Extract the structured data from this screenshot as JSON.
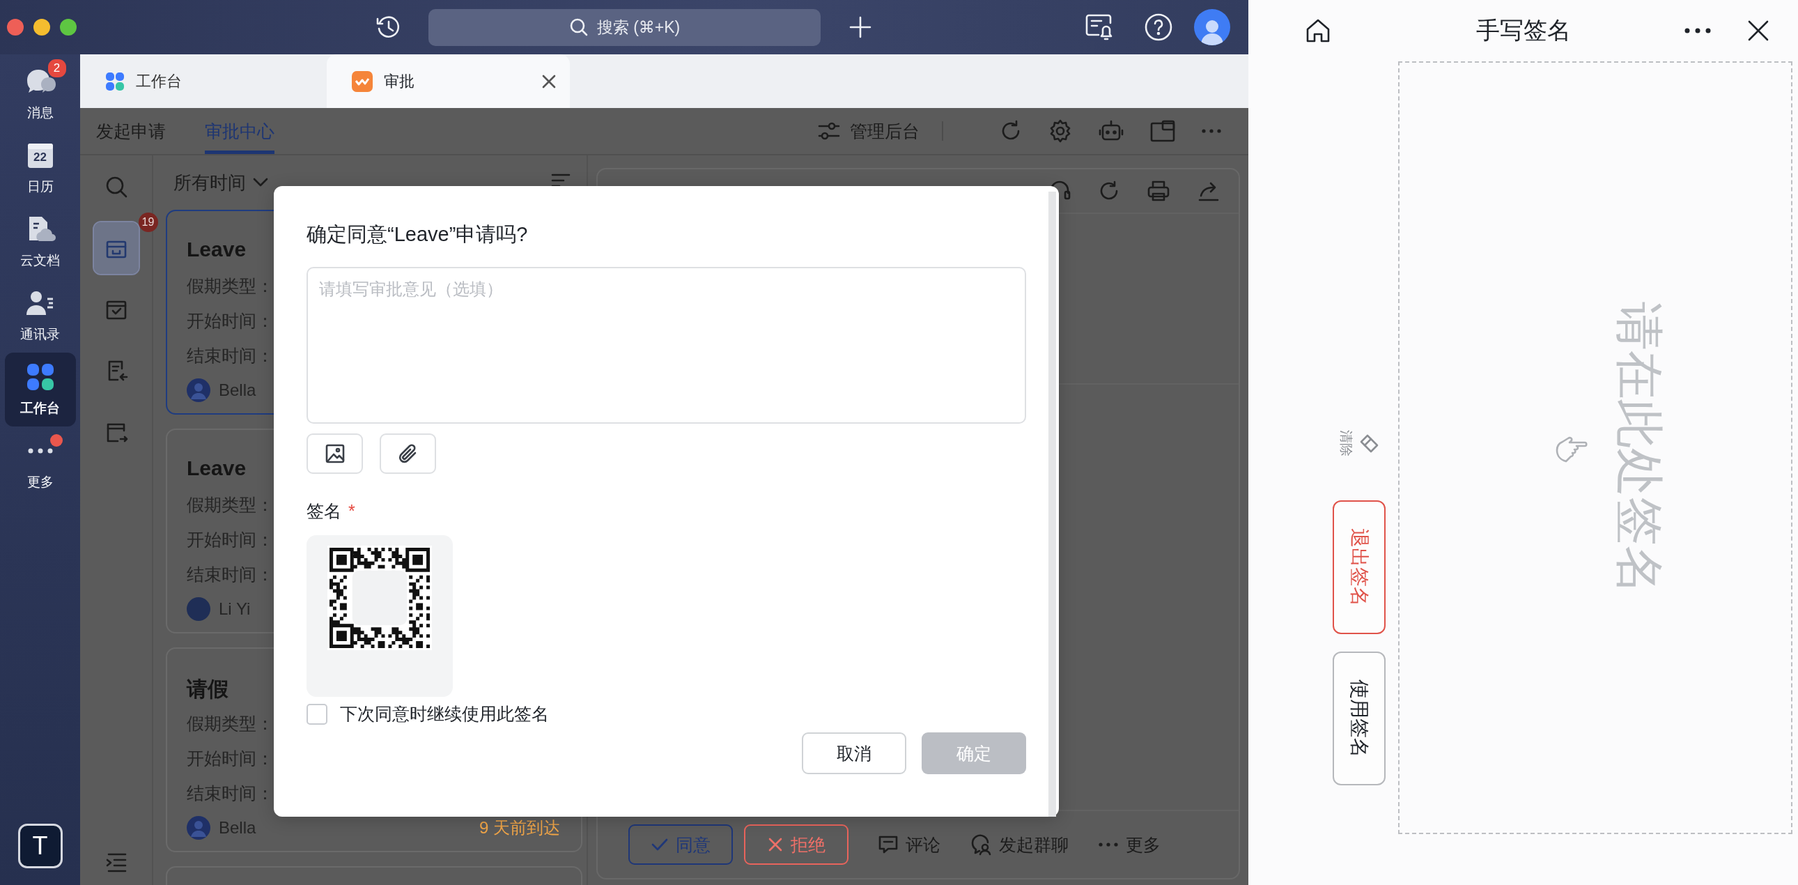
{
  "title_bar": {
    "search": {
      "placeholder": "搜索 (⌘+K)"
    }
  },
  "rail": {
    "items": [
      {
        "kind": "message",
        "label": "消息",
        "badge": "2",
        "selected": false,
        "dot": false
      },
      {
        "kind": "calendar",
        "label": "日历",
        "icon_text": "22",
        "selected": false,
        "dot": false
      },
      {
        "kind": "docs",
        "label": "云文档",
        "selected": false,
        "dot": false
      },
      {
        "kind": "contacts",
        "label": "通讯录",
        "selected": false,
        "dot": false
      },
      {
        "kind": "workspace",
        "label": "工作台",
        "selected": true,
        "dot": false
      },
      {
        "kind": "more",
        "label": "更多",
        "selected": false,
        "dot": true
      }
    ],
    "avatar_letter": "T"
  },
  "tabs": [
    {
      "kind": "workspace",
      "label": "工作台",
      "selected": false
    },
    {
      "kind": "approval",
      "label": "审批",
      "selected": true
    }
  ],
  "sub_nav": {
    "tabs": [
      {
        "label": "发起申请",
        "selected": false
      },
      {
        "label": "审批中心",
        "selected": true
      }
    ],
    "admin_label": "管理后台"
  },
  "side_icons": [
    {
      "kind": "inbox",
      "selected": true,
      "badge": "19"
    },
    {
      "kind": "archive",
      "selected": false
    },
    {
      "kind": "sent",
      "selected": false
    },
    {
      "kind": "tray",
      "selected": false
    }
  ],
  "list": {
    "filter": "所有时间",
    "cards": [
      {
        "title": "Leave",
        "fields": [
          "假期类型：",
          "开始时间：",
          "结束时间："
        ],
        "user": "Bella",
        "avatar": {
          "kind": "person"
        },
        "selected": true
      },
      {
        "title": "Leave",
        "fields": [
          "假期类型：",
          "开始时间：",
          "结束时间："
        ],
        "user": "Li Yi",
        "avatar": {
          "kind": "plain"
        },
        "selected": false
      },
      {
        "title": "请假",
        "fields": [
          "假期类型：",
          "开始时间：",
          "结束时间："
        ],
        "user": "Bella",
        "avatar": {
          "kind": "person"
        },
        "selected": false,
        "arrival": "9 天前到达"
      },
      {
        "selected": false
      }
    ]
  },
  "detail": {
    "actions": [
      {
        "kind": "approve",
        "label": "同意"
      },
      {
        "kind": "reject",
        "label": "拒绝"
      },
      {
        "kind": "comment",
        "label": "评论"
      },
      {
        "kind": "group",
        "label": "发起群聊"
      },
      {
        "kind": "more",
        "label": "更多"
      }
    ]
  },
  "dialog": {
    "title": "确定同意“Leave”申请吗?",
    "comment": {
      "placeholder": "请填写审批意见（选填）"
    },
    "signature_label": "签名",
    "required_mark": "*",
    "remember": {
      "label": "下次同意时继续使用此签名",
      "checked": false
    },
    "buttons": [
      {
        "kind": "secondary",
        "label": "取消",
        "disabled": false
      },
      {
        "kind": "primary",
        "label": "确定",
        "disabled": true
      }
    ]
  },
  "signature_pad": {
    "title": "手写签名",
    "clear_label": "清除",
    "buttons": [
      {
        "kind": "exit",
        "label": "退出签名"
      },
      {
        "kind": "use",
        "label": "使用签名"
      }
    ],
    "hint": "请在此处签名"
  }
}
